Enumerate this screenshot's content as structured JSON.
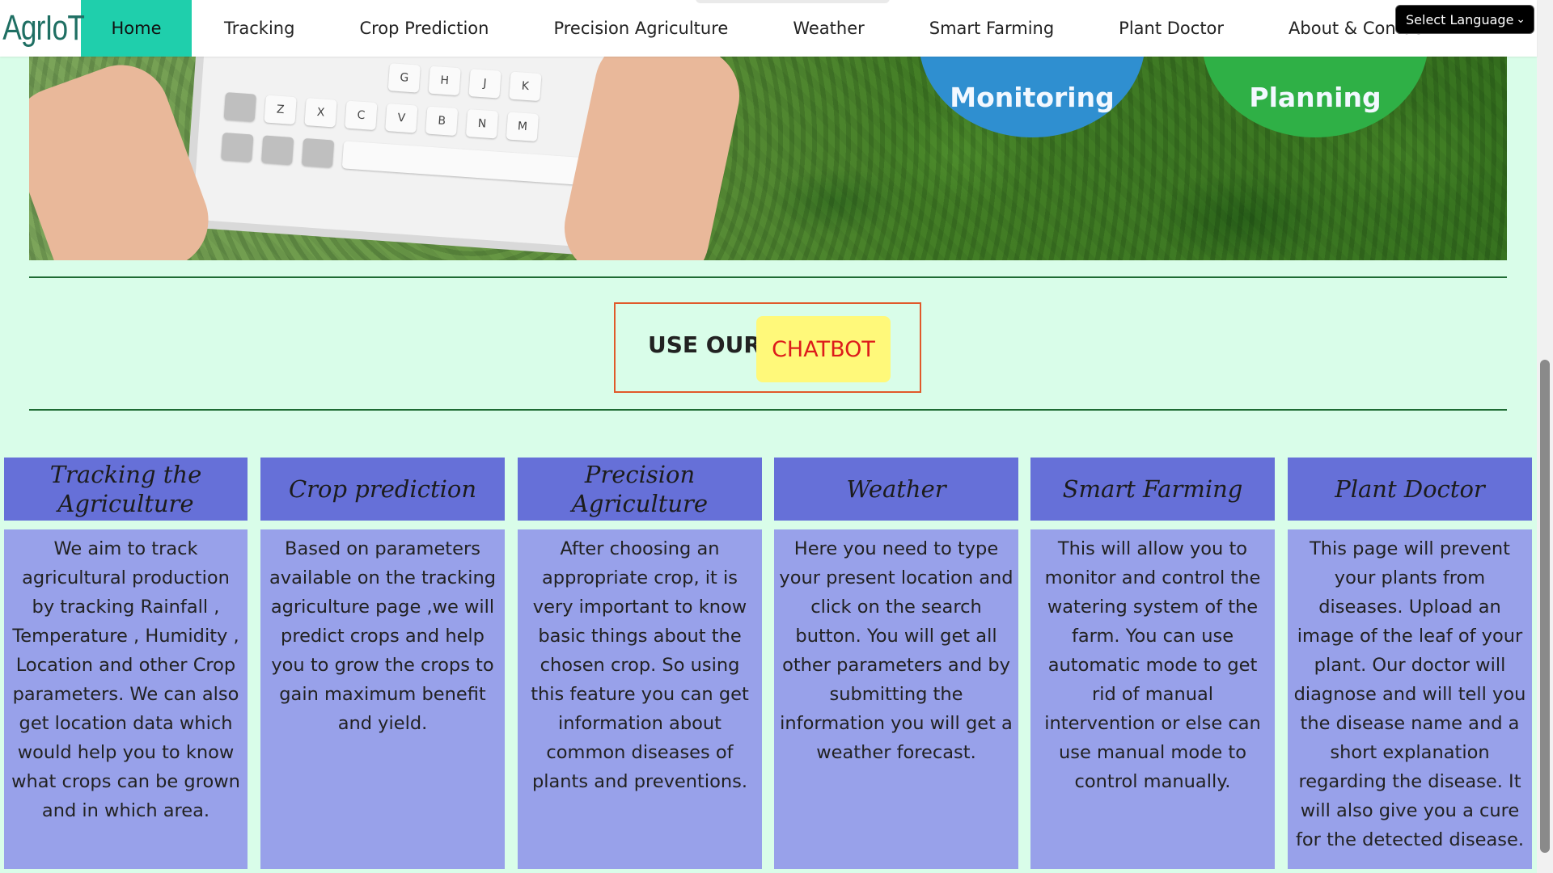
{
  "navbar": {
    "logo": "AgrIoT",
    "items": [
      {
        "label": "Home",
        "active": true
      },
      {
        "label": "Tracking"
      },
      {
        "label": "Crop Prediction"
      },
      {
        "label": "Precision Agriculture"
      },
      {
        "label": "Weather"
      },
      {
        "label": "Smart Farming"
      },
      {
        "label": "Plant Doctor"
      },
      {
        "label": "About & Contact"
      }
    ],
    "language_select": "Select Language"
  },
  "hero": {
    "badges": [
      "Monitoring",
      "Planning"
    ],
    "keys_row1": [
      "G",
      "H",
      "J",
      "K"
    ],
    "keys_row2": [
      "Z",
      "X",
      "C",
      "V",
      "B",
      "N",
      "M"
    ]
  },
  "chatbot": {
    "label": "USE OUR",
    "button": "CHATBOT"
  },
  "cards": [
    {
      "title": "Tracking the Agriculture",
      "text": "We aim to track agricultural production by tracking Rainfall , Temperature , Humidity , Location and other Crop parameters. We can also get location data which would help you to know what crops can be grown and in which area."
    },
    {
      "title": "Crop prediction",
      "text": "Based on parameters available on the tracking agriculture page ,we will predict crops and help you to grow the crops to gain maximum benefit and yield."
    },
    {
      "title": "Precision Agriculture",
      "text": "After choosing an appropriate crop, it is very important to know basic things about the chosen crop. So using this feature you can get information about common diseases of plants and preventions."
    },
    {
      "title": "Weather",
      "text": "Here you need to type your present location and click on the search button. You will get all other parameters and by submitting the information you will get a weather forecast."
    },
    {
      "title": "Smart Farming",
      "text": "This will allow you to monitor and control the watering system of the farm. You can use automatic mode to get rid of manual intervention or else can use manual mode to control manually."
    },
    {
      "title": "Plant Doctor",
      "text": "This page will prevent your plants from diseases. Upload an image of the leaf of your plant. Our doctor will diagnose and will tell you the disease name and a short explanation regarding the disease. It will also give you a cure for the detected disease."
    }
  ],
  "colors": {
    "page_bg": "#d9fde9",
    "nav_active": "#1fcfac",
    "card_head": "#6670d8",
    "card_body": "#98a1ea",
    "chat_border": "#e0592a",
    "chat_button_bg": "#fff97a",
    "chat_button_text": "#dd1b1b",
    "divider": "#1e6b33"
  }
}
